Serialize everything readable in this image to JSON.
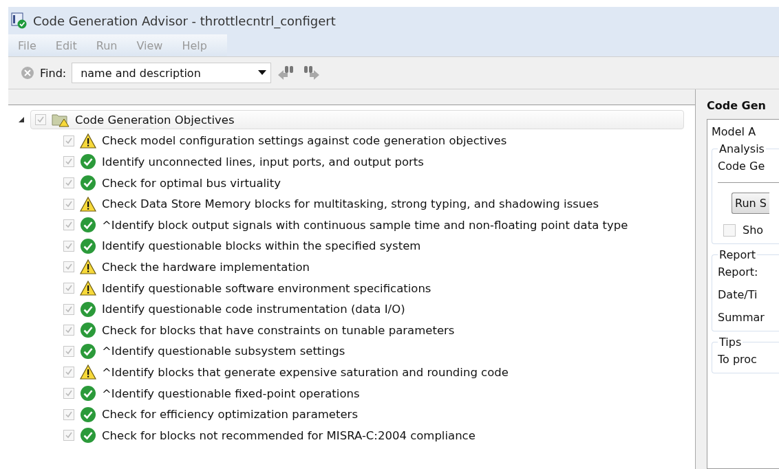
{
  "window": {
    "title": "Code Generation Advisor - throttlecntrl_configert"
  },
  "menu": [
    "File",
    "Edit",
    "Run",
    "View",
    "Help"
  ],
  "toolbar": {
    "find_label": "Find:",
    "find_value": "name and description"
  },
  "tree": {
    "label": "Code Generation Objectives",
    "expanded": true,
    "checked": true,
    "kind": "warning",
    "children": [
      {
        "label": "Check model configuration settings against code generation objectives",
        "checked": true,
        "kind": "warning"
      },
      {
        "label": "Identify unconnected lines, input ports, and output ports",
        "checked": true,
        "kind": "passed"
      },
      {
        "label": "Check for optimal bus virtuality",
        "checked": true,
        "kind": "passed"
      },
      {
        "label": "Check Data Store Memory blocks for multitasking, strong typing, and shadowing issues",
        "checked": true,
        "kind": "warning"
      },
      {
        "label": "^Identify block output signals with continuous sample time and non-floating point data type",
        "checked": true,
        "kind": "passed"
      },
      {
        "label": "Identify questionable blocks within the specified system",
        "checked": true,
        "kind": "passed"
      },
      {
        "label": "Check the hardware implementation",
        "checked": true,
        "kind": "warning"
      },
      {
        "label": "Identify questionable software environment specifications",
        "checked": true,
        "kind": "warning"
      },
      {
        "label": "Identify questionable code instrumentation (data I/O)",
        "checked": true,
        "kind": "passed"
      },
      {
        "label": "Check for blocks that have constraints on tunable parameters",
        "checked": true,
        "kind": "passed"
      },
      {
        "label": "^Identify questionable subsystem settings",
        "checked": true,
        "kind": "passed"
      },
      {
        "label": "^Identify blocks that generate expensive saturation and rounding code",
        "checked": true,
        "kind": "warning"
      },
      {
        "label": "^Identify questionable fixed-point operations",
        "checked": true,
        "kind": "passed"
      },
      {
        "label": "Check for efficiency optimization parameters",
        "checked": true,
        "kind": "passed"
      },
      {
        "label": "Check for blocks not recommended for MISRA-C:2004 compliance",
        "checked": true,
        "kind": "passed"
      }
    ]
  },
  "details": {
    "heading": "Code Gen",
    "model_label": "Model A",
    "analysis": {
      "legend": "Analysis",
      "label": "Code Ge",
      "run_button": "Run S",
      "show_checkbox": {
        "label": "Sho",
        "checked": false
      }
    },
    "report": {
      "legend": "Report",
      "rows": [
        "Report:",
        "Date/Ti",
        "Summar"
      ]
    },
    "tips": {
      "legend": "Tips",
      "text": "To proc"
    }
  }
}
